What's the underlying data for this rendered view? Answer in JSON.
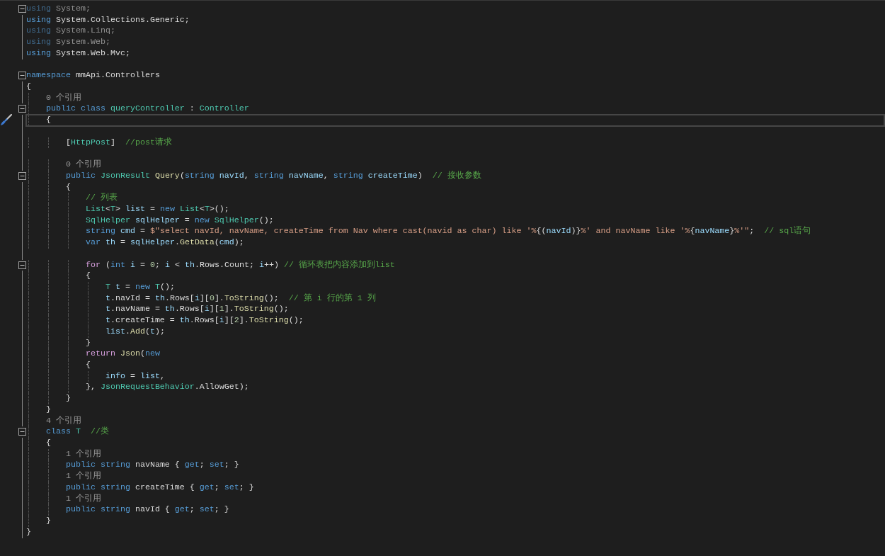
{
  "editor": {
    "lines": [
      {
        "kind": "code",
        "faded": true,
        "collapsible": true,
        "tokens": [
          {
            "kind": "kw",
            "text": "using"
          },
          {
            "kind": "txt",
            "text": " System;"
          }
        ]
      },
      {
        "kind": "code",
        "faded": false,
        "tokens": [
          {
            "kind": "kw",
            "text": "using"
          },
          {
            "kind": "txt",
            "text": " System.Collections.Generic;"
          }
        ]
      },
      {
        "kind": "code",
        "faded": true,
        "tokens": [
          {
            "kind": "kw",
            "text": "using"
          },
          {
            "kind": "txt",
            "text": " System.Linq;"
          }
        ]
      },
      {
        "kind": "code",
        "faded": true,
        "tokens": [
          {
            "kind": "kw",
            "text": "using"
          },
          {
            "kind": "txt",
            "text": " System.Web;"
          }
        ]
      },
      {
        "kind": "code",
        "faded": false,
        "tokens": [
          {
            "kind": "kw",
            "text": "using"
          },
          {
            "kind": "txt",
            "text": " System.Web.Mvc;"
          }
        ]
      },
      {
        "kind": "blank"
      },
      {
        "kind": "code",
        "collapsible": true,
        "tokens": [
          {
            "kind": "kw",
            "text": "namespace"
          },
          {
            "kind": "txt",
            "text": " mmApi.Controllers"
          }
        ]
      },
      {
        "kind": "code",
        "tokens": [
          {
            "kind": "txt",
            "text": "{"
          }
        ]
      },
      {
        "kind": "lens",
        "tokens": [
          {
            "kind": "lens",
            "text": "    0 个引用"
          }
        ]
      },
      {
        "kind": "code",
        "collapsible": true,
        "tokens": [
          {
            "kind": "kw",
            "text": "    public class"
          },
          {
            "kind": "type",
            "text": " queryController"
          },
          {
            "kind": "txt",
            "text": " :"
          },
          {
            "kind": "type",
            "text": " Controller"
          }
        ]
      },
      {
        "kind": "code",
        "current": true,
        "tokens": [
          {
            "kind": "txt",
            "text": "    {"
          }
        ]
      },
      {
        "kind": "blank"
      },
      {
        "kind": "code",
        "tokens": [
          {
            "kind": "txt",
            "text": "        ["
          },
          {
            "kind": "type",
            "text": "HttpPost"
          },
          {
            "kind": "txt",
            "text": "]"
          },
          {
            "kind": "cmt",
            "text": "  //post请求"
          }
        ]
      },
      {
        "kind": "blank"
      },
      {
        "kind": "lens",
        "tokens": [
          {
            "kind": "lens",
            "text": "        0 个引用"
          }
        ]
      },
      {
        "kind": "code",
        "collapsible": true,
        "tokens": [
          {
            "kind": "kw",
            "text": "        public"
          },
          {
            "kind": "type",
            "text": " JsonResult"
          },
          {
            "kind": "fn",
            "text": " Query"
          },
          {
            "kind": "txt",
            "text": "("
          },
          {
            "kind": "kw",
            "text": "string"
          },
          {
            "kind": "var",
            "text": " navId"
          },
          {
            "kind": "txt",
            "text": ","
          },
          {
            "kind": "kw",
            "text": " string"
          },
          {
            "kind": "var",
            "text": " navName"
          },
          {
            "kind": "txt",
            "text": ","
          },
          {
            "kind": "kw",
            "text": " string"
          },
          {
            "kind": "var",
            "text": " createTime"
          },
          {
            "kind": "txt",
            "text": ")"
          },
          {
            "kind": "cmt",
            "text": "  // 接收参数"
          }
        ]
      },
      {
        "kind": "code",
        "tokens": [
          {
            "kind": "txt",
            "text": "        {"
          }
        ]
      },
      {
        "kind": "code",
        "tokens": [
          {
            "kind": "cmt",
            "text": "            // 列表"
          }
        ]
      },
      {
        "kind": "code",
        "tokens": [
          {
            "kind": "type",
            "text": "            List"
          },
          {
            "kind": "txt",
            "text": "<"
          },
          {
            "kind": "type",
            "text": "T"
          },
          {
            "kind": "txt",
            "text": ">"
          },
          {
            "kind": "var",
            "text": " list"
          },
          {
            "kind": "txt",
            "text": " ="
          },
          {
            "kind": "kw",
            "text": " new"
          },
          {
            "kind": "type",
            "text": " List"
          },
          {
            "kind": "txt",
            "text": "<"
          },
          {
            "kind": "type",
            "text": "T"
          },
          {
            "kind": "txt",
            "text": ">();"
          }
        ]
      },
      {
        "kind": "code",
        "tokens": [
          {
            "kind": "type",
            "text": "            SqlHelper"
          },
          {
            "kind": "var",
            "text": " sqlHelper"
          },
          {
            "kind": "txt",
            "text": " ="
          },
          {
            "kind": "kw",
            "text": " new"
          },
          {
            "kind": "type",
            "text": " SqlHelper"
          },
          {
            "kind": "txt",
            "text": "();"
          }
        ]
      },
      {
        "kind": "code",
        "tokens": [
          {
            "kind": "kw",
            "text": "            string"
          },
          {
            "kind": "var",
            "text": " cmd"
          },
          {
            "kind": "txt",
            "text": " ="
          },
          {
            "kind": "str",
            "text": " $\"select navId, navName, createTime from Nav where cast(navid as char) like '%"
          },
          {
            "kind": "txt",
            "text": "{("
          },
          {
            "kind": "var",
            "text": "navId"
          },
          {
            "kind": "txt",
            "text": ")}"
          },
          {
            "kind": "str",
            "text": "%' and navName like '%"
          },
          {
            "kind": "txt",
            "text": "{"
          },
          {
            "kind": "var",
            "text": "navName"
          },
          {
            "kind": "txt",
            "text": "}"
          },
          {
            "kind": "str",
            "text": "%'\""
          },
          {
            "kind": "txt",
            "text": ";"
          },
          {
            "kind": "cmt",
            "text": "  // sql语句"
          }
        ]
      },
      {
        "kind": "code",
        "tokens": [
          {
            "kind": "kw",
            "text": "            var"
          },
          {
            "kind": "var",
            "text": " th"
          },
          {
            "kind": "txt",
            "text": " ="
          },
          {
            "kind": "var",
            "text": " sqlHelper"
          },
          {
            "kind": "txt",
            "text": "."
          },
          {
            "kind": "fn",
            "text": "GetData"
          },
          {
            "kind": "txt",
            "text": "("
          },
          {
            "kind": "var",
            "text": "cmd"
          },
          {
            "kind": "txt",
            "text": ");"
          }
        ]
      },
      {
        "kind": "blank"
      },
      {
        "kind": "code",
        "collapsible": true,
        "tokens": [
          {
            "kind": "ctrl",
            "text": "            for"
          },
          {
            "kind": "txt",
            "text": " ("
          },
          {
            "kind": "kw",
            "text": "int"
          },
          {
            "kind": "var",
            "text": " i"
          },
          {
            "kind": "txt",
            "text": " ="
          },
          {
            "kind": "num",
            "text": " 0"
          },
          {
            "kind": "txt",
            "text": ";"
          },
          {
            "kind": "var",
            "text": " i"
          },
          {
            "kind": "txt",
            "text": " <"
          },
          {
            "kind": "var",
            "text": " th"
          },
          {
            "kind": "txt",
            "text": ".Rows.Count;"
          },
          {
            "kind": "var",
            "text": " i"
          },
          {
            "kind": "txt",
            "text": "++)"
          },
          {
            "kind": "cmt",
            "text": " // 循环表把内容添加到list"
          }
        ]
      },
      {
        "kind": "code",
        "tokens": [
          {
            "kind": "txt",
            "text": "            {"
          }
        ]
      },
      {
        "kind": "code",
        "tokens": [
          {
            "kind": "type",
            "text": "                T"
          },
          {
            "kind": "var",
            "text": " t"
          },
          {
            "kind": "txt",
            "text": " ="
          },
          {
            "kind": "kw",
            "text": " new"
          },
          {
            "kind": "type",
            "text": " T"
          },
          {
            "kind": "txt",
            "text": "();"
          }
        ]
      },
      {
        "kind": "code",
        "tokens": [
          {
            "kind": "var",
            "text": "                t"
          },
          {
            "kind": "txt",
            "text": ".navId ="
          },
          {
            "kind": "var",
            "text": " th"
          },
          {
            "kind": "txt",
            "text": ".Rows["
          },
          {
            "kind": "var",
            "text": "i"
          },
          {
            "kind": "txt",
            "text": "]["
          },
          {
            "kind": "num",
            "text": "0"
          },
          {
            "kind": "txt",
            "text": "]."
          },
          {
            "kind": "fn",
            "text": "ToString"
          },
          {
            "kind": "txt",
            "text": "();"
          },
          {
            "kind": "cmt",
            "text": "  // 第 i 行的第 1 列"
          }
        ]
      },
      {
        "kind": "code",
        "tokens": [
          {
            "kind": "var",
            "text": "                t"
          },
          {
            "kind": "txt",
            "text": ".navName ="
          },
          {
            "kind": "var",
            "text": " th"
          },
          {
            "kind": "txt",
            "text": ".Rows["
          },
          {
            "kind": "var",
            "text": "i"
          },
          {
            "kind": "txt",
            "text": "]["
          },
          {
            "kind": "num",
            "text": "1"
          },
          {
            "kind": "txt",
            "text": "]."
          },
          {
            "kind": "fn",
            "text": "ToString"
          },
          {
            "kind": "txt",
            "text": "();"
          }
        ]
      },
      {
        "kind": "code",
        "tokens": [
          {
            "kind": "var",
            "text": "                t"
          },
          {
            "kind": "txt",
            "text": ".createTime ="
          },
          {
            "kind": "var",
            "text": " th"
          },
          {
            "kind": "txt",
            "text": ".Rows["
          },
          {
            "kind": "var",
            "text": "i"
          },
          {
            "kind": "txt",
            "text": "]["
          },
          {
            "kind": "num",
            "text": "2"
          },
          {
            "kind": "txt",
            "text": "]."
          },
          {
            "kind": "fn",
            "text": "ToString"
          },
          {
            "kind": "txt",
            "text": "();"
          }
        ]
      },
      {
        "kind": "code",
        "tokens": [
          {
            "kind": "var",
            "text": "                list"
          },
          {
            "kind": "txt",
            "text": "."
          },
          {
            "kind": "fn",
            "text": "Add"
          },
          {
            "kind": "txt",
            "text": "("
          },
          {
            "kind": "var",
            "text": "t"
          },
          {
            "kind": "txt",
            "text": ");"
          }
        ]
      },
      {
        "kind": "code",
        "tokens": [
          {
            "kind": "txt",
            "text": "            }"
          }
        ]
      },
      {
        "kind": "code",
        "tokens": [
          {
            "kind": "ctrl",
            "text": "            return"
          },
          {
            "kind": "fn",
            "text": " Json"
          },
          {
            "kind": "txt",
            "text": "("
          },
          {
            "kind": "kw",
            "text": "new"
          }
        ]
      },
      {
        "kind": "code",
        "tokens": [
          {
            "kind": "txt",
            "text": "            {"
          }
        ]
      },
      {
        "kind": "code",
        "tokens": [
          {
            "kind": "var",
            "text": "                info"
          },
          {
            "kind": "txt",
            "text": " ="
          },
          {
            "kind": "var",
            "text": " list"
          },
          {
            "kind": "txt",
            "text": ","
          }
        ]
      },
      {
        "kind": "code",
        "tokens": [
          {
            "kind": "txt",
            "text": "            },"
          },
          {
            "kind": "type",
            "text": " JsonRequestBehavior"
          },
          {
            "kind": "txt",
            "text": ".AllowGet);"
          }
        ]
      },
      {
        "kind": "code",
        "tokens": [
          {
            "kind": "txt",
            "text": "        }"
          }
        ]
      },
      {
        "kind": "code",
        "tokens": [
          {
            "kind": "txt",
            "text": "    }"
          }
        ]
      },
      {
        "kind": "lens",
        "tokens": [
          {
            "kind": "lens",
            "text": "    4 个引用"
          }
        ]
      },
      {
        "kind": "code",
        "collapsible": true,
        "tokens": [
          {
            "kind": "kw",
            "text": "    class"
          },
          {
            "kind": "type",
            "text": " T"
          },
          {
            "kind": "cmt",
            "text": "  //类"
          }
        ]
      },
      {
        "kind": "code",
        "tokens": [
          {
            "kind": "txt",
            "text": "    {"
          }
        ]
      },
      {
        "kind": "lens",
        "tokens": [
          {
            "kind": "lens",
            "text": "        1 个引用"
          }
        ]
      },
      {
        "kind": "code",
        "tokens": [
          {
            "kind": "kw",
            "text": "        public string"
          },
          {
            "kind": "txt",
            "text": " navName {"
          },
          {
            "kind": "kw",
            "text": " get"
          },
          {
            "kind": "txt",
            "text": ";"
          },
          {
            "kind": "kw",
            "text": " set"
          },
          {
            "kind": "txt",
            "text": "; }"
          }
        ]
      },
      {
        "kind": "lens",
        "tokens": [
          {
            "kind": "lens",
            "text": "        1 个引用"
          }
        ]
      },
      {
        "kind": "code",
        "tokens": [
          {
            "kind": "kw",
            "text": "        public string"
          },
          {
            "kind": "txt",
            "text": " createTime {"
          },
          {
            "kind": "kw",
            "text": " get"
          },
          {
            "kind": "txt",
            "text": ";"
          },
          {
            "kind": "kw",
            "text": " set"
          },
          {
            "kind": "txt",
            "text": "; }"
          }
        ]
      },
      {
        "kind": "lens",
        "tokens": [
          {
            "kind": "lens",
            "text": "        1 个引用"
          }
        ]
      },
      {
        "kind": "code",
        "tokens": [
          {
            "kind": "kw",
            "text": "        public string"
          },
          {
            "kind": "txt",
            "text": " navId {"
          },
          {
            "kind": "kw",
            "text": " get"
          },
          {
            "kind": "txt",
            "text": ";"
          },
          {
            "kind": "kw",
            "text": " set"
          },
          {
            "kind": "txt",
            "text": "; }"
          }
        ]
      },
      {
        "kind": "code",
        "tokens": [
          {
            "kind": "txt",
            "text": "    }"
          }
        ]
      },
      {
        "kind": "code",
        "tokens": [
          {
            "kind": "txt",
            "text": "}"
          }
        ]
      }
    ]
  }
}
